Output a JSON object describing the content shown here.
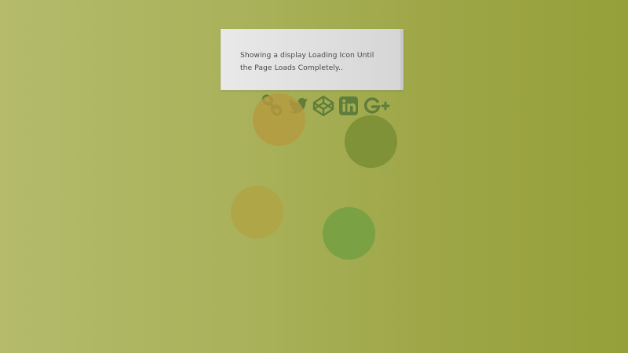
{
  "banner": {
    "text": "Showing a display Loading Icon Until the Page Loads Completely.."
  },
  "social_icons": [
    {
      "name": "link-icon"
    },
    {
      "name": "twitter-icon"
    },
    {
      "name": "codepen-icon"
    },
    {
      "name": "linkedin-icon"
    },
    {
      "name": "google-plus-icon"
    }
  ],
  "colors": {
    "icon": "#5f7d3c",
    "dot_orange": "#b59a3e",
    "dot_dark_green": "#7b8f35",
    "dot_gold": "#b0a444",
    "dot_green": "#76a041"
  }
}
